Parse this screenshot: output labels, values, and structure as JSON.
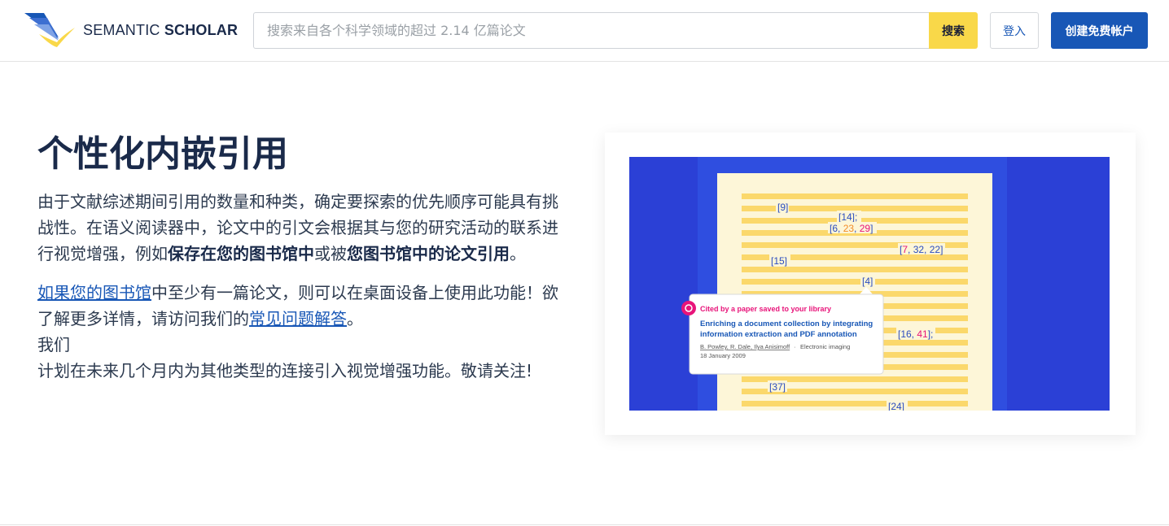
{
  "header": {
    "logo_text_light": "SEMANTIC ",
    "logo_text_bold": "SCHOLAR",
    "search_placeholder": "搜索来自各个科学领域的超过 2.14 亿篇论文",
    "search_button": "搜索",
    "login_button": "登入",
    "signup_button": "创建免费帐户"
  },
  "main": {
    "title": "个性化内嵌引用",
    "para1_a": "由于文献综述期间引用的数量和种类，确定要探索的优先顺序可能具有挑战性。在语义阅读器中，论文中的引文会根据其与您的研究活动的联系进行视觉增强，例如",
    "para1_bold1": "保存在您的图书馆中",
    "para1_b": "或被",
    "para1_bold2": "您图书馆中的论文引用",
    "para1_c": "。",
    "para2_link1": "如果您的图书馆",
    "para2_a": "中至少有一篇论文，则可以在桌面设备上使用此功能！欲了解更多详情，请访问我们的",
    "para2_link2": "常见问题解答",
    "para2_b": "。",
    "para2_line2": "我们",
    "para2_line3": "计划在未来几个月内为其他类型的连接引入视觉增强功能。敬请关注!"
  },
  "illustration": {
    "citations": [
      "[9]",
      "[14];",
      "[6, ",
      "23",
      ", ",
      "29",
      "]",
      "[",
      "7",
      ", 32, 22]",
      "[15]",
      "[4]",
      "[16, ",
      "41",
      "];",
      "[37]",
      "[24]"
    ],
    "popup_tag": "Cited by a paper saved to your library",
    "popup_title_1": "Enriching a document collection by integrating",
    "popup_title_2": "information extraction and PDF annotation",
    "popup_authors": "B. Powley, R. Dale, Ilya Anisimoff",
    "popup_venue": "Electronic imaging",
    "popup_date": "18 January 2009",
    "colors": {
      "blue_bg": "#2b40d6",
      "page": "#fdf6d8",
      "stripe": "#fbd86b",
      "pink": "#e8147a",
      "orange": "#f28c28",
      "cite_blue": "#2b4dbf"
    }
  },
  "colors": {
    "accent_yellow": "#f9d849",
    "brand_blue": "#1857b6",
    "title": "#1a2a4a"
  }
}
